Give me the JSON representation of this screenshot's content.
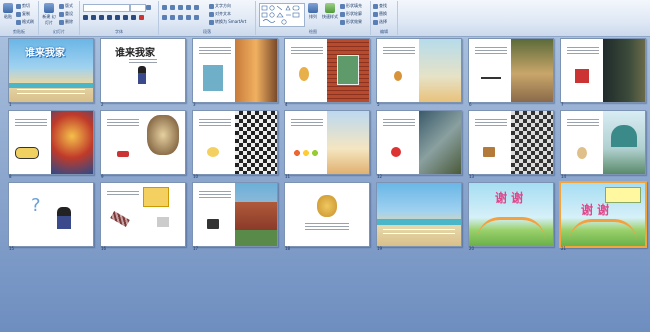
{
  "ribbon": {
    "groups": [
      "剪贴板",
      "幻灯片",
      "字体",
      "段落",
      "绘图",
      "编辑"
    ],
    "clipboard": {
      "paste": "粘贴",
      "cut": "剪切",
      "copy": "复制",
      "format_painter": "格式刷"
    },
    "slides": {
      "new_slide": "新建\n幻灯片",
      "layout": "版式",
      "reset": "重设",
      "delete": "删除"
    },
    "paragraph": {
      "text_direction": "文字方向",
      "align_text": "对齐文本",
      "smartart": "转换为 SmartArt"
    },
    "drawing": {
      "arrange": "排列",
      "quick_styles": "快速样式",
      "shape_fill": "形状填充",
      "shape_outline": "形状轮廓",
      "shape_effects": "形状效果"
    },
    "editing": {
      "find": "查找",
      "replace": "替换",
      "select": "选择"
    }
  },
  "slides": [
    {
      "n": "1",
      "title": "谁来我家"
    },
    {
      "n": "2",
      "title": "谁来我家"
    },
    {
      "n": "3"
    },
    {
      "n": "4"
    },
    {
      "n": "5"
    },
    {
      "n": "6"
    },
    {
      "n": "7"
    },
    {
      "n": "8"
    },
    {
      "n": "9"
    },
    {
      "n": "10"
    },
    {
      "n": "11"
    },
    {
      "n": "12"
    },
    {
      "n": "13"
    },
    {
      "n": "14"
    },
    {
      "n": "15"
    },
    {
      "n": "16"
    },
    {
      "n": "17"
    },
    {
      "n": "18"
    },
    {
      "n": "19"
    },
    {
      "n": "20",
      "title": "谢 谢"
    },
    {
      "n": "21",
      "title": "谢 谢"
    }
  ],
  "colors": {
    "selected_border": "#f3a43a",
    "background": "#8fa9cf"
  }
}
